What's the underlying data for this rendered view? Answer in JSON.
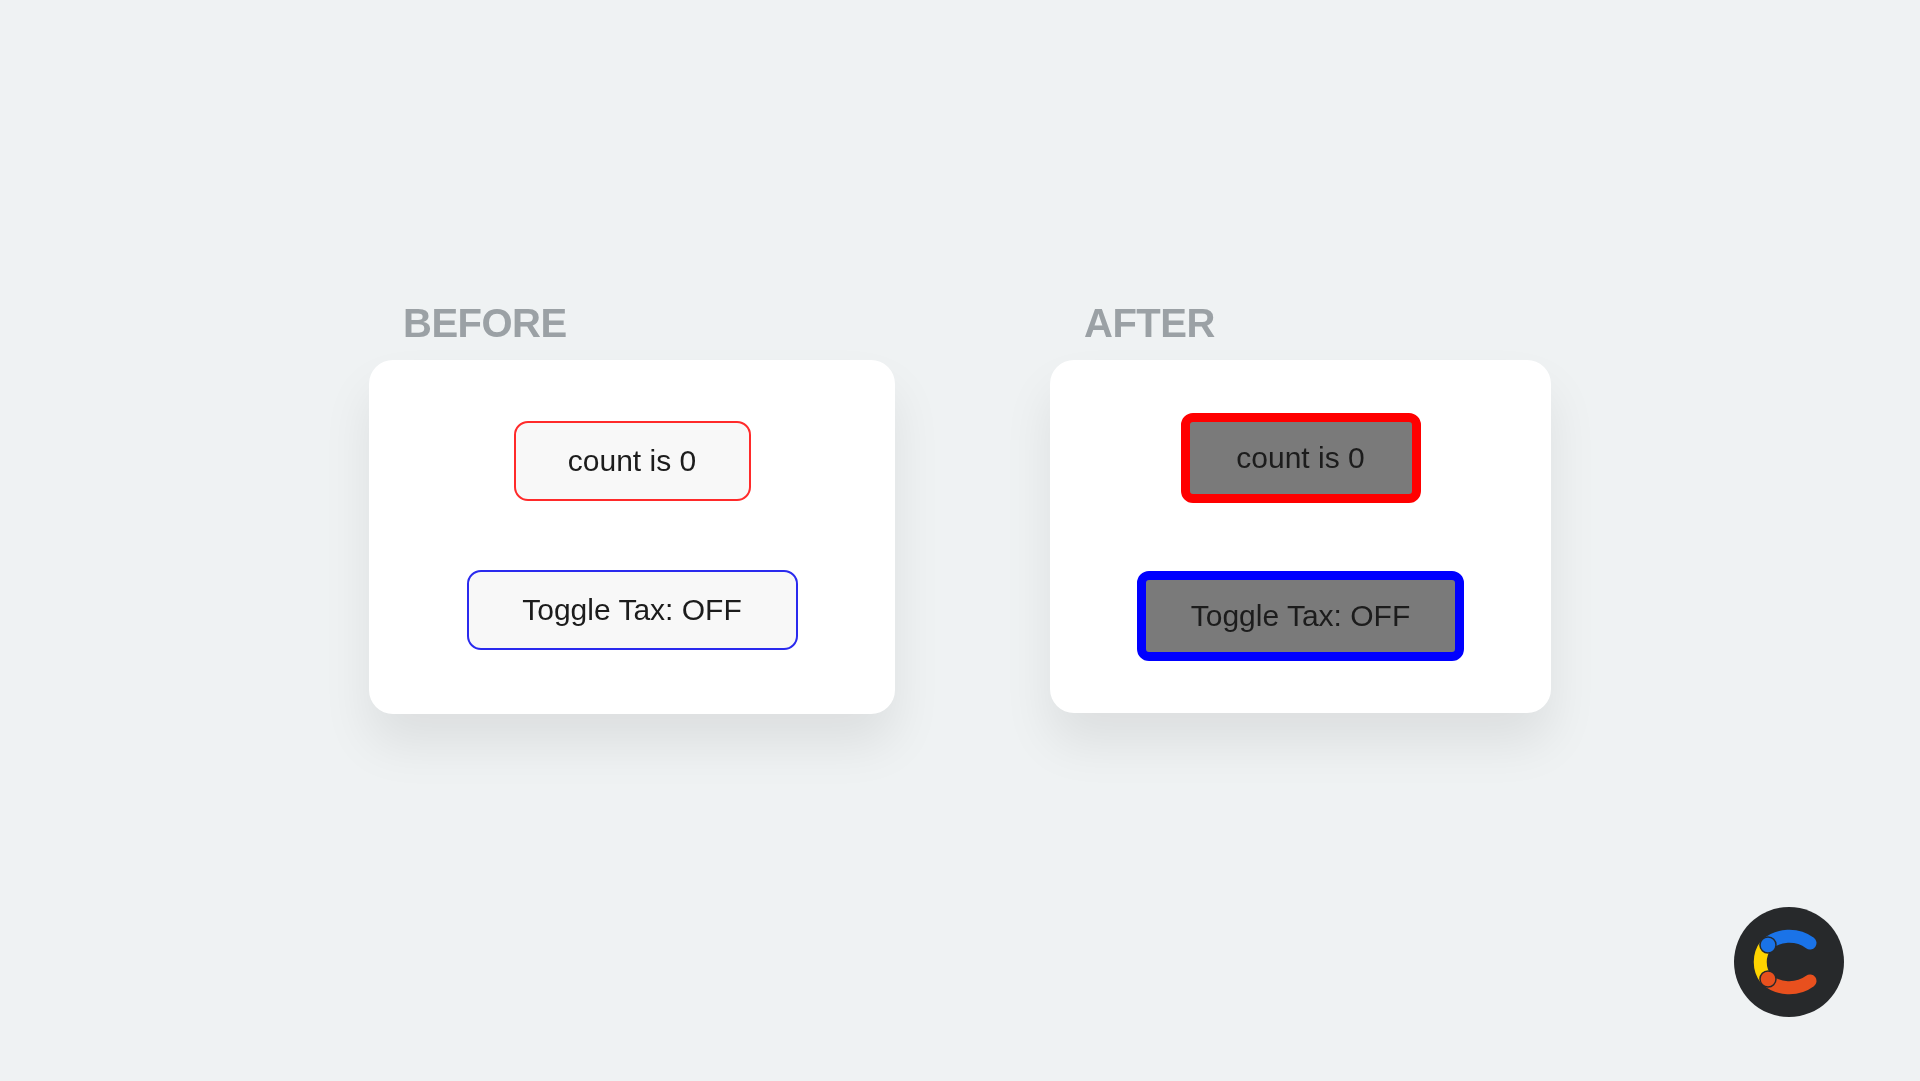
{
  "panels": [
    {
      "title": "BEFORE",
      "kind": "thin",
      "buttons": [
        {
          "label": "count is 0",
          "color": "#ff2a2a"
        },
        {
          "label": "Toggle Tax: OFF",
          "color": "#2a2aee"
        }
      ]
    },
    {
      "title": "AFTER",
      "kind": "thick",
      "buttons": [
        {
          "label": "count is 0",
          "color": "#ff0000"
        },
        {
          "label": "Toggle Tax: OFF",
          "color": "#0000ff"
        }
      ]
    }
  ]
}
